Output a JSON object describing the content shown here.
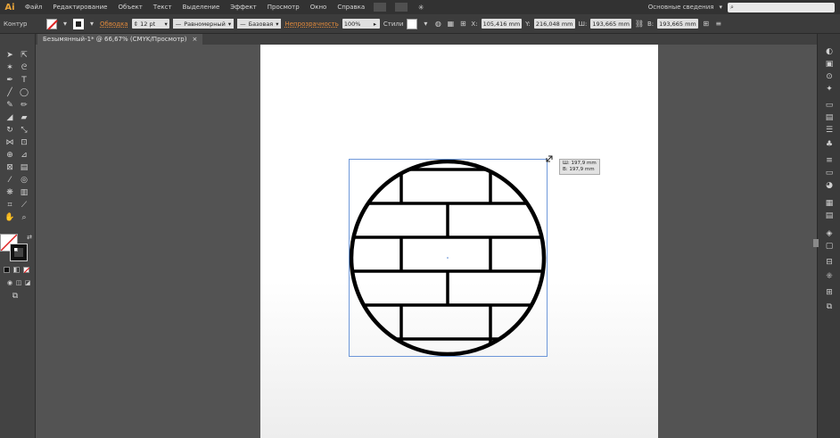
{
  "app": {
    "logo": "Ai"
  },
  "menu": [
    "Файл",
    "Редактирование",
    "Объект",
    "Текст",
    "Выделение",
    "Эффект",
    "Просмотр",
    "Окно",
    "Справка"
  ],
  "workspace": "Основные сведения",
  "search": {
    "placeholder": ""
  },
  "control": {
    "mode": "Контур",
    "stroke_link": "Обводка",
    "stroke_weight": "12 pt",
    "profile": "Равномерный",
    "brush": "Базовая",
    "opacity_link": "Непрозрачность",
    "opacity_value": "100%",
    "styles_label": "Стили",
    "x": "105,416 mm",
    "y": "216,048 mm",
    "w": "193,665 mm",
    "h": "193,665 mm"
  },
  "document": {
    "tab_title": "Безымянный-1* @ 66,67% (CMYK/Просмотр)",
    "close": "×"
  },
  "tooltip": {
    "w": "Ш: 197,9 mm",
    "h": "В: 197,9 mm"
  },
  "colors": {
    "accent": "#e38a3b",
    "stroke": "#000000",
    "selection": "#4a7fd1"
  }
}
